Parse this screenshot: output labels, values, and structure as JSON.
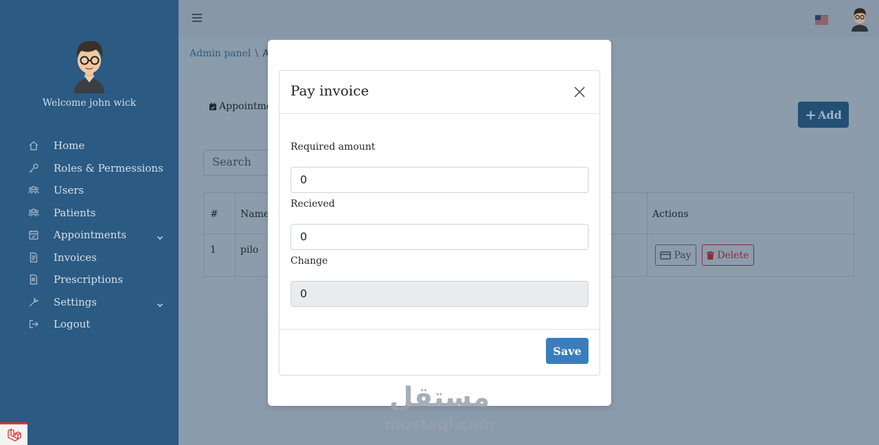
{
  "sidebar": {
    "welcome": "Welcome john wick",
    "items": [
      {
        "label": "Home",
        "icon": "home-icon",
        "chevron": false
      },
      {
        "label": "Roles & Permessions",
        "icon": "key-icon",
        "chevron": false
      },
      {
        "label": "Users",
        "icon": "users-icon",
        "chevron": false
      },
      {
        "label": "Patients",
        "icon": "users-icon",
        "chevron": false
      },
      {
        "label": "Appointments",
        "icon": "calendar-check-icon",
        "chevron": true
      },
      {
        "label": "Invoices",
        "icon": "invoice-icon",
        "chevron": false
      },
      {
        "label": "Prescriptions",
        "icon": "prescription-icon",
        "chevron": false
      },
      {
        "label": "Settings",
        "icon": "wrench-icon",
        "chevron": true
      },
      {
        "label": "Logout",
        "icon": "logout-icon",
        "chevron": false
      }
    ]
  },
  "topbar": {
    "menu_icon": "hamburger-icon",
    "language_icon": "us-flag-icon"
  },
  "breadcrumb": {
    "root": "Admin panel",
    "separator": "\\",
    "current": "A"
  },
  "card": {
    "title": "Appointme",
    "add_label": "Add",
    "search_placeholder": "Search"
  },
  "table": {
    "headers": [
      "#",
      "Name",
      "Actions"
    ],
    "rows": [
      {
        "index": "1",
        "name": "pilo",
        "pay_label": "Pay",
        "delete_label": "Delete"
      }
    ]
  },
  "modal": {
    "title": "Pay invoice",
    "fields": [
      {
        "label": "Required amount",
        "value": "0",
        "readonly": false
      },
      {
        "label": "Recieved",
        "value": "0",
        "readonly": false
      },
      {
        "label": "Change",
        "value": "0",
        "readonly": true
      }
    ],
    "save_label": "Save"
  },
  "watermark": {
    "arabic": "مستقل",
    "latin": "mostaql.com"
  },
  "colors": {
    "sidebar": "#2b5a82",
    "primary": "#3a7dbd",
    "danger": "#8a2c3a",
    "overlay": "#8a9bab"
  }
}
